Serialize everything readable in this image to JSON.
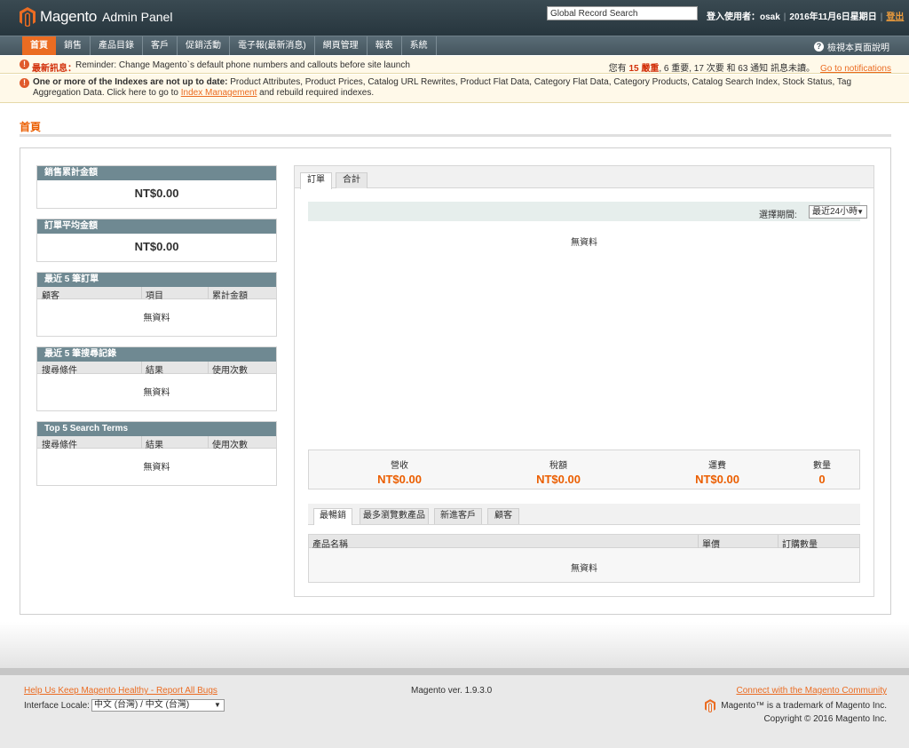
{
  "header": {
    "logo_text": "Magento",
    "logo_sub": "Admin Panel",
    "search_value": "Global Record Search",
    "login_label": "登入使用者：",
    "username": "osak",
    "date": "2016年11月6日星期日",
    "logout": "登出",
    "logo_color": "#eb6c22"
  },
  "nav": {
    "items": [
      "首頁",
      "銷售",
      "產品目錄",
      "客戶",
      "促銷活動",
      "電子報(最新消息)",
      "網頁管理",
      "報表",
      "系統"
    ],
    "help": "檢視本頁面說明"
  },
  "notice": {
    "label": "最新訊息：",
    "message": "Reminder: Change Magento`s default phone numbers and callouts before site launch",
    "right_prefix": "您有",
    "critical_count": "15 嚴重",
    "right_rest": ", 6 重要, 17 次要 和 63 通知 訊息未讀。",
    "link": "Go to notifications"
  },
  "index_notice": {
    "bold": "One or more of the Indexes are not up to date:",
    "text": " Product Attributes, Product Prices, Catalog URL Rewrites, Product Flat Data, Category Flat Data, Category Products, Catalog Search Index, Stock Status, Tag Aggregation Data. Click here to go to ",
    "link": "Index Management",
    "after": " and rebuild required indexes."
  },
  "page_title": "首頁",
  "sidebar": {
    "lifetime_sales": {
      "title": "銷售累計金額",
      "value": "NT$0.00"
    },
    "average_order": {
      "title": "訂單平均金額",
      "value": "NT$0.00"
    },
    "last_orders": {
      "title": "最近 5 筆訂單",
      "columns": [
        "顧客",
        "項目",
        "累計金額"
      ],
      "empty": "無資料"
    },
    "last_search": {
      "title": "最近 5 筆搜尋記錄",
      "columns": [
        "搜尋條件",
        "結果",
        "使用次數"
      ],
      "empty": "無資料"
    },
    "top_search": {
      "title": "Top 5 Search Terms",
      "columns": [
        "搜尋條件",
        "結果",
        "使用次數"
      ],
      "empty": "無資料"
    }
  },
  "chart_panel": {
    "tabs": [
      "訂單",
      "合計"
    ],
    "period_label": "選擇期間:",
    "period_value": "最近24小時",
    "empty": "無資料"
  },
  "totals": [
    {
      "label": "營收",
      "value": "NT$0.00"
    },
    {
      "label": "稅額",
      "value": "NT$0.00"
    },
    {
      "label": "運費",
      "value": "NT$0.00"
    },
    {
      "label": "數量",
      "value": "0"
    }
  ],
  "products_panel": {
    "tabs": [
      "最暢銷",
      "最多瀏覽數產品",
      "新進客戶",
      "顧客"
    ],
    "columns": [
      "產品名稱",
      "單價",
      "訂購數量"
    ],
    "empty": "無資料"
  },
  "footer": {
    "bugs_link": "Help Us Keep Magento Healthy - Report All Bugs",
    "locale_label": "Interface Locale:",
    "locale_value": "中文 (台灣) / 中文 (台灣)",
    "version": "Magento ver. 1.9.3.0",
    "community_link": "Connect with the Magento Community",
    "trademark": "Magento™ is a trademark of Magento Inc.",
    "copyright": "Copyright © 2016 Magento Inc."
  }
}
